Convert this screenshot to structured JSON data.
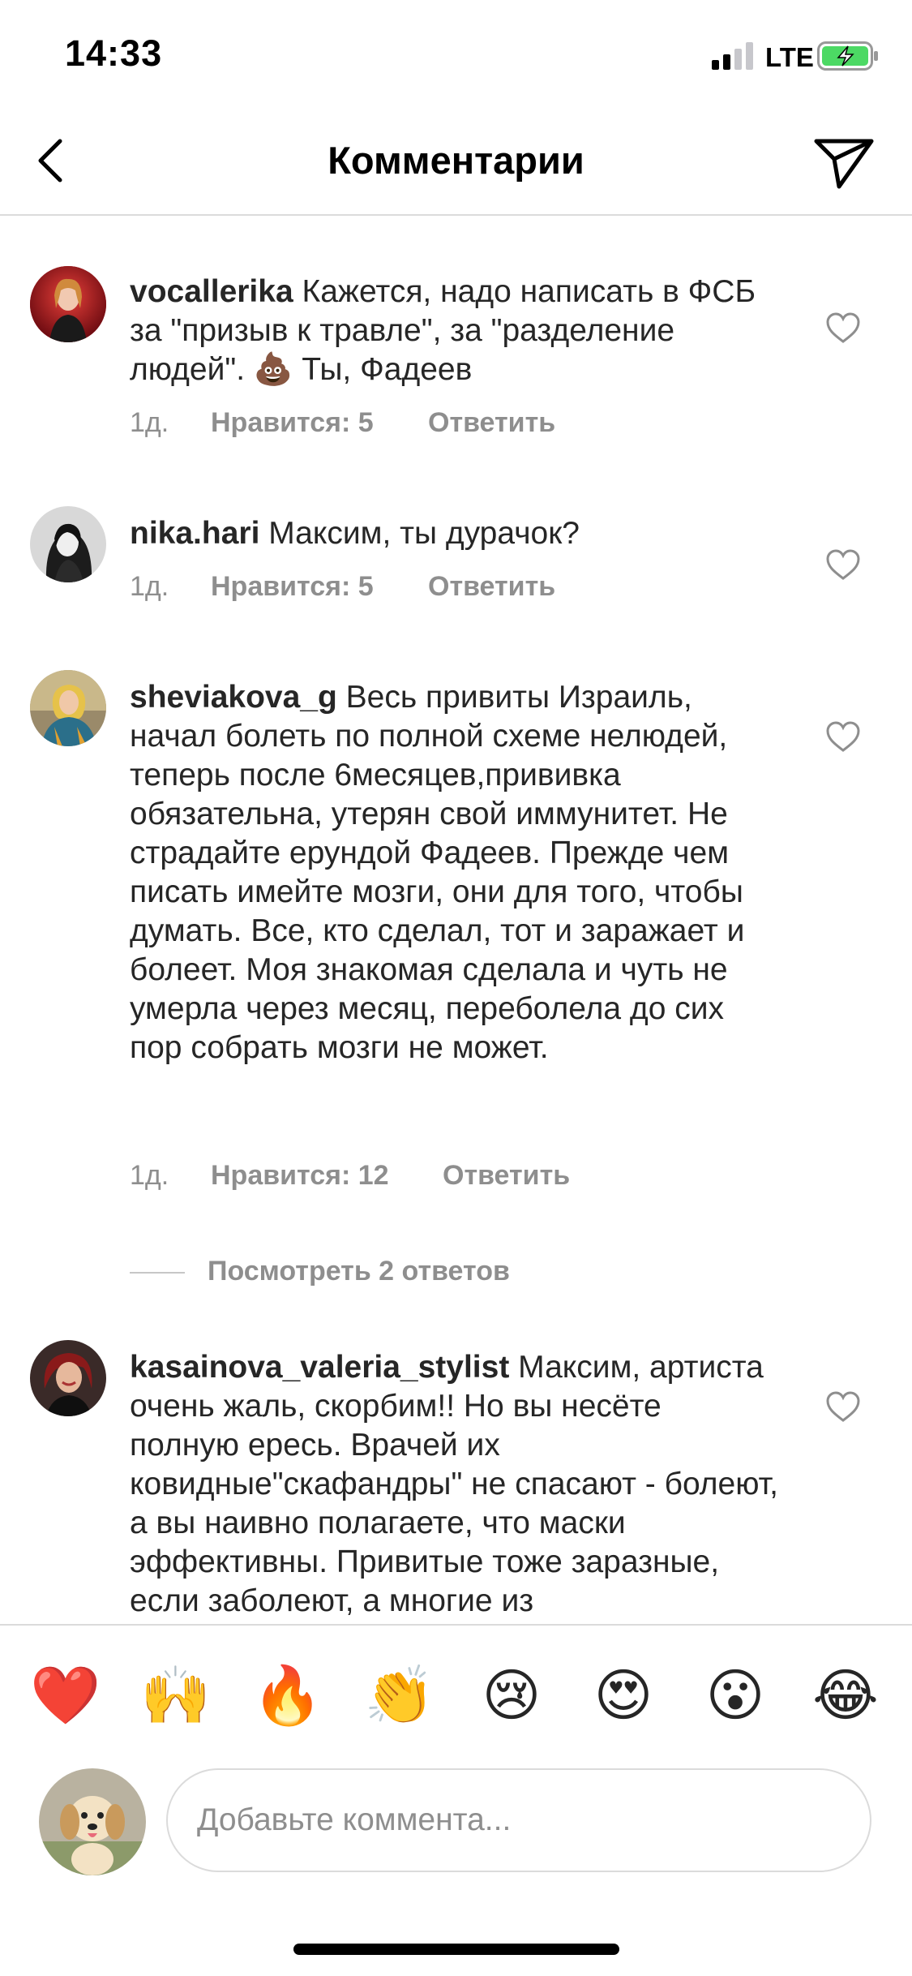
{
  "status_bar": {
    "time": "14:33",
    "network": "LTE"
  },
  "header": {
    "title": "Комментарии",
    "back_icon": "chevron-left-icon",
    "share_icon": "paper-plane-icon"
  },
  "comments": [
    {
      "username": "vocallerika",
      "text": "Кажется, надо написать в ФСБ за \"призыв к травле\", за \"разделение людей\". 💩 Ты, Фадеев",
      "time": "1д.",
      "likes": "Нравится: 5",
      "reply": "Ответить"
    },
    {
      "username": "nika.hari",
      "text": "Максим, ты дурачок?",
      "time": "1д.",
      "likes": "Нравится: 5",
      "reply": "Ответить"
    },
    {
      "username": "sheviakova_g",
      "text": "Весь привиты Израиль, начал болеть по полной схеме нелюдей, теперь после 6месяцев,прививка обязательна, утерян свой иммунитет. Не страдайте ерундой Фадеев. Прежде чем писать имейте мозги, они для того, чтобы думать. Все, кто сделал, тот и заражает и болеет. Моя знакомая сделала и чуть не умерла через месяц, переболела до сих пор собрать мозги не может.",
      "time": "1д.",
      "likes": "Нравится: 12",
      "reply": "Ответить",
      "view_replies": "Посмотреть 2 ответов"
    },
    {
      "username": "kasainova_valeria_stylist",
      "text": "Максим, артиста очень жаль, скорбим!! Но вы несёте полную ересь. Врачей их ковидные\"скафандры\" не спасают - болеют, а вы наивно полагаете, что маски эффективны. Привитые тоже заразные, если заболеют, а многие из"
    }
  ],
  "reactions": [
    "❤️",
    "🙌",
    "🔥",
    "👏",
    "😢",
    "😍",
    "😮",
    "😂"
  ],
  "composer": {
    "placeholder": "Добавьте коммента..."
  },
  "colors": {
    "text": "#262626",
    "secondary": "#8e8e8e",
    "divider": "#dbdbdb",
    "battery": "#4cd964"
  }
}
